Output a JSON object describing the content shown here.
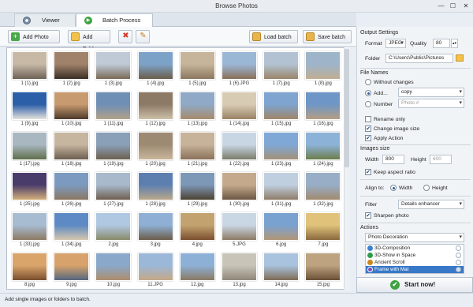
{
  "window": {
    "title": "Browse Photos"
  },
  "tabs": [
    {
      "label": "Viewer"
    },
    {
      "label": "Batch Process"
    }
  ],
  "toolbar": {
    "add_photo": "Add Photo",
    "add_folder": "Add Folder",
    "load_batch": "Load batch",
    "save_batch": "Save batch"
  },
  "images": [
    {
      "cap": "1 (1).jpg",
      "c1": "#c7b9a6",
      "c2": "#6e6257"
    },
    {
      "cap": "1 (2).jpg",
      "c1": "#a0826a",
      "c2": "#3b2e25"
    },
    {
      "cap": "1 (3).jpg",
      "c1": "#bfcad6",
      "c2": "#7a6a57"
    },
    {
      "cap": "1 (4).jpg",
      "c1": "#7da2c8",
      "c2": "#6c5d4a"
    },
    {
      "cap": "1 (5).jpg",
      "c1": "#c6b59a",
      "c2": "#8b7760"
    },
    {
      "cap": "1 (6).JPG",
      "c1": "#9bb7d6",
      "c2": "#8a6f58"
    },
    {
      "cap": "1 (7).jpg",
      "c1": "#b2c2d2",
      "c2": "#9a8469"
    },
    {
      "cap": "1 (8).jpg",
      "c1": "#9eb4c9",
      "c2": "#c0ae93"
    },
    {
      "cap": "1 (9).jpg",
      "c1": "#2b5fa8",
      "c2": "#e5e2dc"
    },
    {
      "cap": "1 (10).jpg",
      "c1": "#c79a6f",
      "c2": "#4d3a2a"
    },
    {
      "cap": "1 (11).jpg",
      "c1": "#6f8fb5",
      "c2": "#b2a187"
    },
    {
      "cap": "1 (12).jpg",
      "c1": "#8c7a66",
      "c2": "#cdbfa8"
    },
    {
      "cap": "1 (13).jpg",
      "c1": "#8fa9c6",
      "c2": "#a78b6c"
    },
    {
      "cap": "1 (14).jpg",
      "c1": "#d8cbb4",
      "c2": "#9a8265"
    },
    {
      "cap": "1 (15).jpg",
      "c1": "#7ea4cf",
      "c2": "#a08569"
    },
    {
      "cap": "1 (16).jpg",
      "c1": "#6e96c6",
      "c2": "#b59e82"
    },
    {
      "cap": "1 (17).jpg",
      "c1": "#a9b7c1",
      "c2": "#5f6e4b"
    },
    {
      "cap": "1 (18).jpg",
      "c1": "#c6b6a0",
      "c2": "#6d5e4f"
    },
    {
      "cap": "1 (19).jpg",
      "c1": "#8aa0b8",
      "c2": "#6c6050"
    },
    {
      "cap": "1 (20).jpg",
      "c1": "#9d8a73",
      "c2": "#c9b79b"
    },
    {
      "cap": "1 (21).jpg",
      "c1": "#c7b29a",
      "c2": "#8a715a"
    },
    {
      "cap": "1 (22).jpg",
      "c1": "#c8d6e4",
      "c2": "#7b7c6a"
    },
    {
      "cap": "1 (23).jpg",
      "c1": "#7fa8d6",
      "c2": "#a49178"
    },
    {
      "cap": "1 (24).jpg",
      "c1": "#8db2d8",
      "c2": "#6c7d4b"
    },
    {
      "cap": "1 (25).jpg",
      "c1": "#4a3c6a",
      "c2": "#d4b07a"
    },
    {
      "cap": "1 (26).jpg",
      "c1": "#7c9ac0",
      "c2": "#8a7760"
    },
    {
      "cap": "1 (27).jpg",
      "c1": "#a7b9cb",
      "c2": "#6f5f4f"
    },
    {
      "cap": "1 (28).jpg",
      "c1": "#5d7fb0",
      "c2": "#b9a78a"
    },
    {
      "cap": "1 (29).jpg",
      "c1": "#7d97b6",
      "c2": "#4c4232"
    },
    {
      "cap": "1 (30).jpg",
      "c1": "#c4a98c",
      "c2": "#6c5743"
    },
    {
      "cap": "1 (31).jpg",
      "c1": "#bfcfe0",
      "c2": "#8e7c67"
    },
    {
      "cap": "1 (32).jpg",
      "c1": "#98aec6",
      "c2": "#a08a6f"
    },
    {
      "cap": "1 (33).jpg",
      "c1": "#a7bbd1",
      "c2": "#8d7a63"
    },
    {
      "cap": "1 (34).jpg",
      "c1": "#5d8ac4",
      "c2": "#d6c7ad"
    },
    {
      "cap": "2.jpg",
      "c1": "#b0c8e2",
      "c2": "#8a8a6a"
    },
    {
      "cap": "3.jpg",
      "c1": "#8fb0d4",
      "c2": "#6b5d49"
    },
    {
      "cap": "4.jpg",
      "c1": "#c2a36f",
      "c2": "#7b4f2e"
    },
    {
      "cap": "5.JPG",
      "c1": "#c9d6e3",
      "c2": "#8d7b65"
    },
    {
      "cap": "6.jpg",
      "c1": "#79a2d0",
      "c2": "#b29677"
    },
    {
      "cap": "7.jpg",
      "c1": "#e0c27a",
      "c2": "#8a6a3e"
    },
    {
      "cap": "8.jpg",
      "c1": "#d9a56a",
      "c2": "#7a4f2e"
    },
    {
      "cap": "9.jpg",
      "c1": "#d7a26b",
      "c2": "#54667f"
    },
    {
      "cap": "10.jpg",
      "c1": "#89a8ca",
      "c2": "#ae8e6c"
    },
    {
      "cap": "11.JPG",
      "c1": "#9bb8d8",
      "c2": "#c5a888"
    },
    {
      "cap": "12.jpg",
      "c1": "#8db0d6",
      "c2": "#8a7a64"
    },
    {
      "cap": "13.jpg",
      "c1": "#c8c4b8",
      "c2": "#8e8879"
    },
    {
      "cap": "14.jpg",
      "c1": "#a9c3de",
      "c2": "#7f6c55"
    },
    {
      "cap": "15.jpg",
      "c1": "#bda37f",
      "c2": "#6a5036"
    }
  ],
  "status": {
    "text": "Add single images or folders to batch."
  },
  "output": {
    "section": "Output Settings",
    "format_label": "Format",
    "format_value": "JPEG",
    "quality_label": "Quality",
    "quality_value": "80",
    "folder_label": "Folder",
    "folder_value": "C:\\Users\\Public\\Pictures"
  },
  "file_names": {
    "section": "File Names",
    "without": "Without changes",
    "add": "Add...",
    "add_value": "copy",
    "number": "Number",
    "number_placeholder": "Photo #",
    "rename": "Rename only",
    "change_size": "Change image size",
    "apply": "Apply Action"
  },
  "images_size": {
    "section": "Images size",
    "width_label": "Width",
    "width_value": "800",
    "height_label": "Height",
    "height_value": "600",
    "keep": "Keep aspect ratio",
    "align_label": "Align to:",
    "align_width": "Width",
    "align_height": "Height"
  },
  "filter": {
    "label": "Filter",
    "value": "Details enhancer",
    "sharpen": "Sharpen photo"
  },
  "actions": {
    "section": "Actions",
    "select_value": "Photo Decoration",
    "items": [
      {
        "label": "3D-Composition",
        "color": "#3f7fd0"
      },
      {
        "label": "3D-Show in Space",
        "color": "#2e9a4b"
      },
      {
        "label": "Ancient Scroll",
        "color": "#c8871f"
      },
      {
        "label": "Frame with Mat",
        "color": "#7a4fb5"
      }
    ]
  },
  "start": {
    "label": "Start now!"
  },
  "colors": {
    "accent": "#3778c7",
    "start_green": "#3ea340"
  }
}
